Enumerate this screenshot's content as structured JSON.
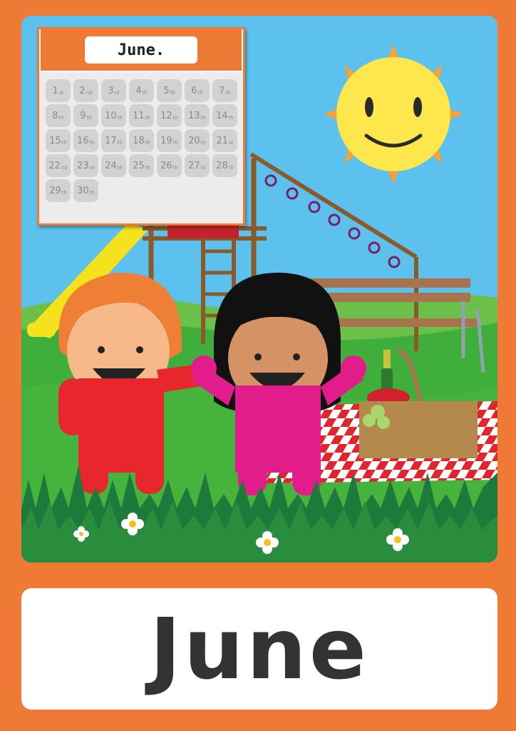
{
  "calendar": {
    "title": "June.",
    "days": [
      {
        "num": "1",
        "suffix": "st"
      },
      {
        "num": "2",
        "suffix": "nd"
      },
      {
        "num": "3",
        "suffix": "rd"
      },
      {
        "num": "4",
        "suffix": "th"
      },
      {
        "num": "5",
        "suffix": "th"
      },
      {
        "num": "6",
        "suffix": "th"
      },
      {
        "num": "7",
        "suffix": "th"
      },
      {
        "num": "8",
        "suffix": "th"
      },
      {
        "num": "9",
        "suffix": "th"
      },
      {
        "num": "10",
        "suffix": "th"
      },
      {
        "num": "11",
        "suffix": "th"
      },
      {
        "num": "12",
        "suffix": "th"
      },
      {
        "num": "13",
        "suffix": "th"
      },
      {
        "num": "14",
        "suffix": "th"
      },
      {
        "num": "15",
        "suffix": "th"
      },
      {
        "num": "16",
        "suffix": "th"
      },
      {
        "num": "17",
        "suffix": "th"
      },
      {
        "num": "18",
        "suffix": "th"
      },
      {
        "num": "19",
        "suffix": "th"
      },
      {
        "num": "20",
        "suffix": "th"
      },
      {
        "num": "21",
        "suffix": "st"
      },
      {
        "num": "22",
        "suffix": "nd"
      },
      {
        "num": "23",
        "suffix": "rd"
      },
      {
        "num": "24",
        "suffix": "th"
      },
      {
        "num": "25",
        "suffix": "th"
      },
      {
        "num": "26",
        "suffix": "th"
      },
      {
        "num": "27",
        "suffix": "th"
      },
      {
        "num": "28",
        "suffix": "th"
      },
      {
        "num": "29",
        "suffix": "th"
      },
      {
        "num": "30",
        "suffix": "th"
      }
    ]
  },
  "label": "June",
  "colors": {
    "border": "#ee7a35",
    "sky": "#5cc1ec",
    "grass": "#3fae3a",
    "sun": "#fde74c",
    "child_left_shirt": "#e8262d",
    "child_right_shirt": "#e31c8c"
  },
  "illustration": {
    "icons": [
      "sun-icon",
      "playground-slide-icon",
      "park-bench-icon",
      "picnic-basket-icon",
      "flower-icon"
    ]
  }
}
